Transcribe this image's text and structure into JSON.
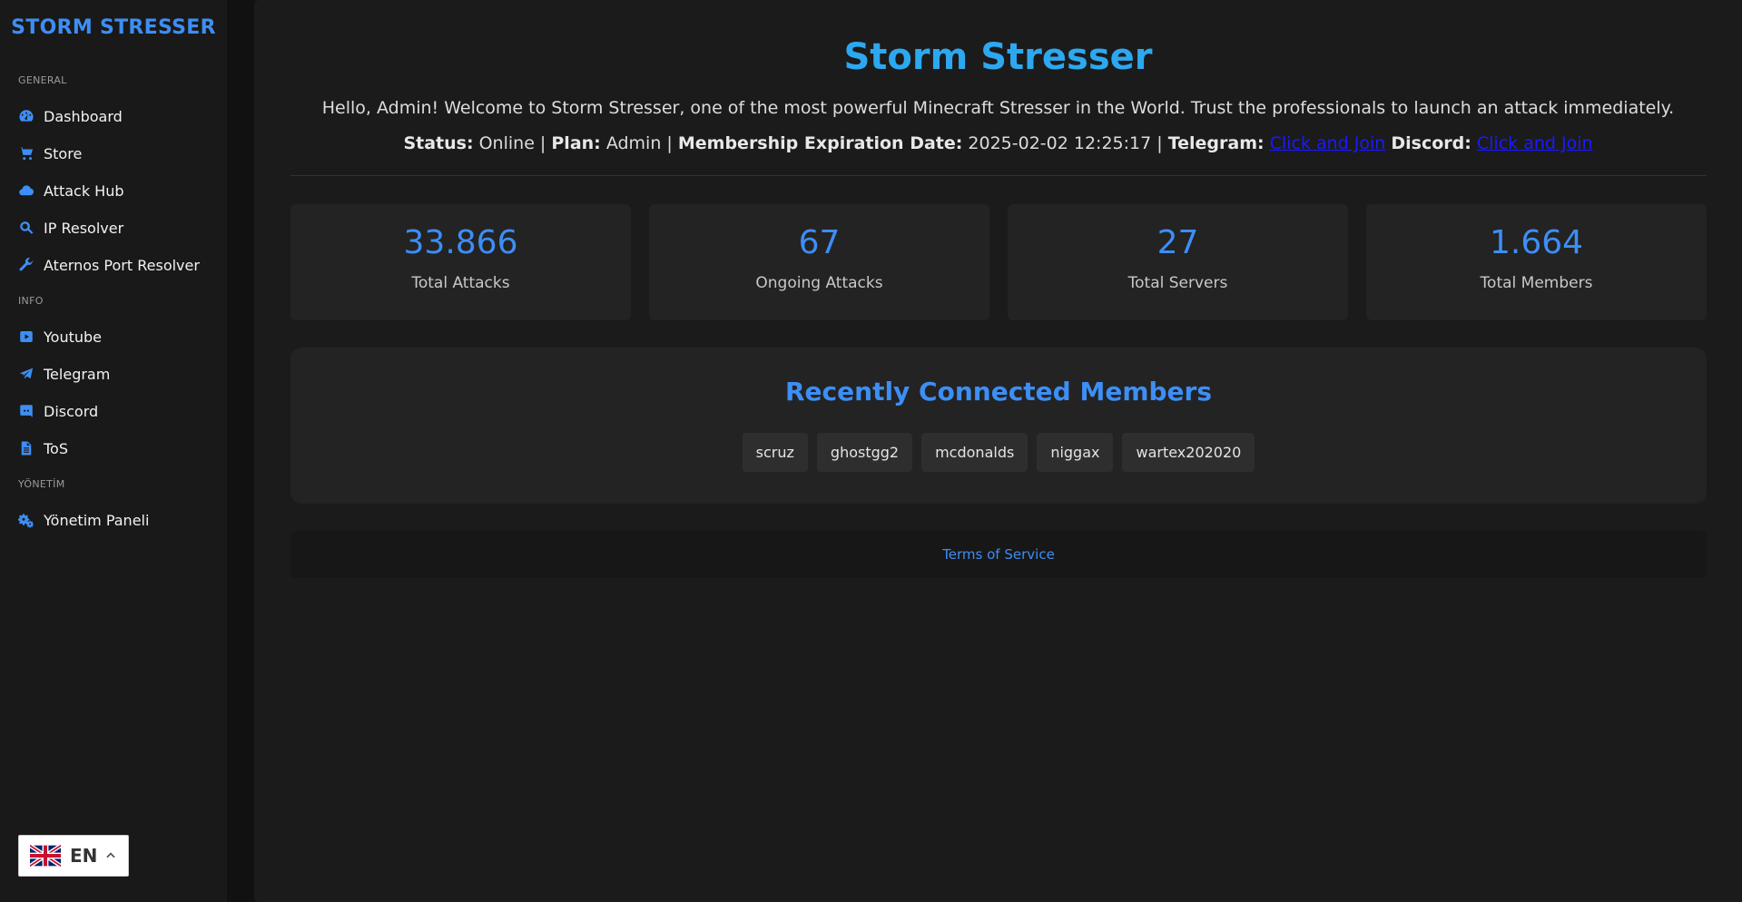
{
  "sidebar": {
    "brand": "STORM STRESSER",
    "sections": {
      "general": "GENERAL",
      "info": "INFO",
      "management": "YÖNETİM"
    },
    "items": {
      "dashboard": "Dashboard",
      "store": "Store",
      "attack_hub": "Attack Hub",
      "ip_resolver": "IP Resolver",
      "aternos": "Aternos Port Resolver",
      "youtube": "Youtube",
      "telegram": "Telegram",
      "discord": "Discord",
      "tos": "ToS",
      "admin_panel": "Yönetim Paneli"
    },
    "language": "EN"
  },
  "main": {
    "title": "Storm Stresser",
    "welcome": "Hello, Admin! Welcome to Storm Stresser, one of the most powerful Minecraft Stresser in the World. Trust the professionals to launch an attack immediately.",
    "status": {
      "status_label": "Status:",
      "status_value": "Online",
      "plan_label": "Plan:",
      "plan_value": "Admin",
      "expiry_label": "Membership Expiration Date:",
      "expiry_value": "2025-02-02 12:25:17",
      "telegram_label": "Telegram:",
      "telegram_link": "Click and Join",
      "discord_label": "Discord:",
      "discord_link": "Click and Join"
    },
    "stats": {
      "total_attacks": {
        "value": "33.866",
        "label": "Total Attacks"
      },
      "ongoing_attacks": {
        "value": "67",
        "label": "Ongoing Attacks"
      },
      "total_servers": {
        "value": "27",
        "label": "Total Servers"
      },
      "total_members": {
        "value": "1.664",
        "label": "Total Members"
      }
    },
    "members": {
      "heading": "Recently Connected Members",
      "list": [
        "scruz",
        "ghostgg2",
        "mcdonalds",
        "niggax",
        "wartex202020"
      ]
    },
    "footer_link": "Terms of Service"
  },
  "colors": {
    "accent": "#3d8ef5",
    "title": "#2da8f0",
    "link": "#1a1aff"
  }
}
